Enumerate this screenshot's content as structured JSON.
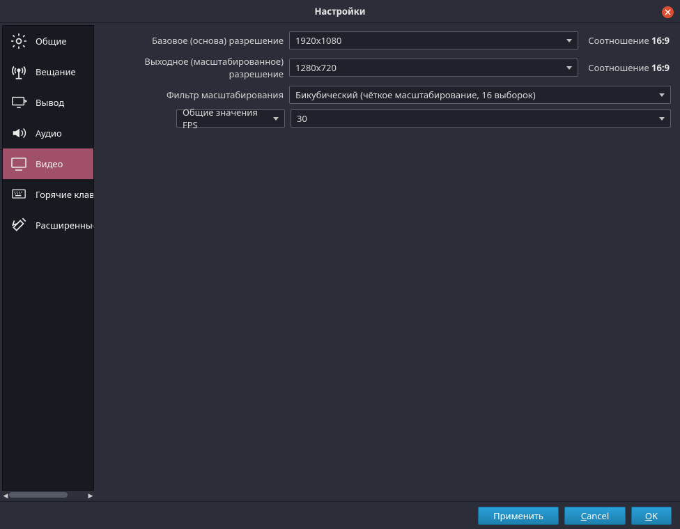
{
  "window": {
    "title": "Настройки"
  },
  "sidebar": {
    "items": [
      {
        "label": "Общие"
      },
      {
        "label": "Вещание"
      },
      {
        "label": "Вывод"
      },
      {
        "label": "Аудио"
      },
      {
        "label": "Видео"
      },
      {
        "label": "Горячие клавиши"
      },
      {
        "label": "Расширенные"
      }
    ]
  },
  "settings": {
    "base_res_label": "Базовое (основа) разрешение",
    "base_res_value": "1920x1080",
    "base_ratio_label": "Соотношение",
    "base_ratio_value": "16:9",
    "output_res_label": "Выходное (масштабированное) разрешение",
    "output_res_value": "1280x720",
    "output_ratio_label": "Соотношение",
    "output_ratio_value": "16:9",
    "filter_label": "Фильтр масштабирования",
    "filter_value": "Бикубический (чёткое масштабирование, 16 выборок)",
    "fps_mode_label": "Общие значения FPS",
    "fps_value": "30"
  },
  "footer": {
    "apply": "Применить",
    "cancel_pre": "",
    "cancel_u": "C",
    "cancel_post": "ancel",
    "ok_pre": "",
    "ok_u": "O",
    "ok_post": "K"
  }
}
